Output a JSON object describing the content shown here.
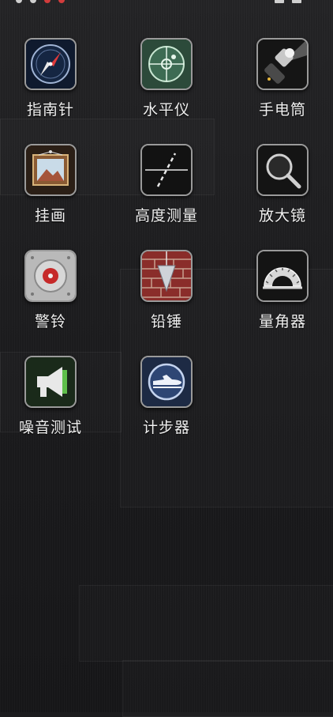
{
  "apps": [
    {
      "label": "指南针",
      "icon": "compass-icon"
    },
    {
      "label": "水平仪",
      "icon": "level-icon"
    },
    {
      "label": "手电筒",
      "icon": "flashlight-icon"
    },
    {
      "label": "挂画",
      "icon": "picture-frame-icon"
    },
    {
      "label": "高度测量",
      "icon": "height-measure-icon"
    },
    {
      "label": "放大镜",
      "icon": "magnifier-icon"
    },
    {
      "label": "警铃",
      "icon": "alarm-bell-icon"
    },
    {
      "label": "铅锤",
      "icon": "plumb-bob-icon"
    },
    {
      "label": "量角器",
      "icon": "protractor-icon"
    },
    {
      "label": "噪音测试",
      "icon": "megaphone-icon"
    },
    {
      "label": "计步器",
      "icon": "pedometer-icon"
    }
  ]
}
